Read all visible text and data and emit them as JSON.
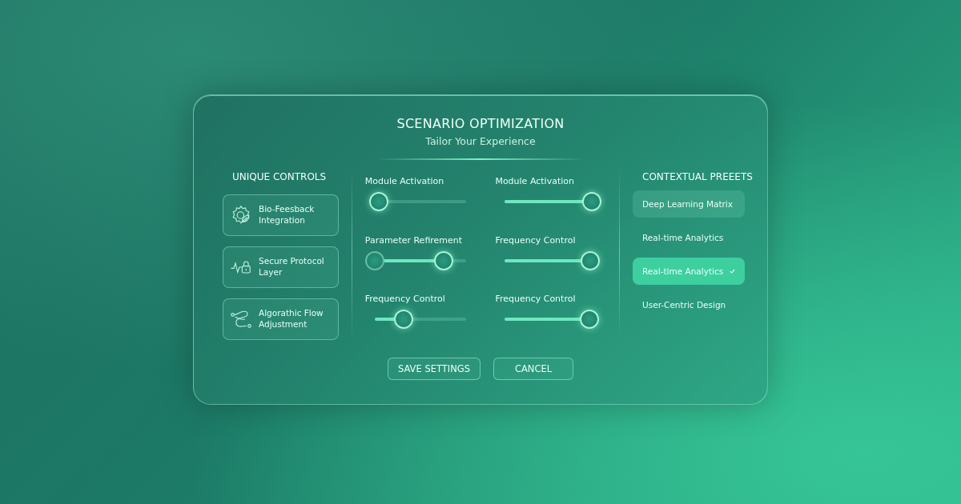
{
  "panel": {
    "title": "SCENARIO OPTIMIZATION",
    "subtitle": "Tailor Your Experience"
  },
  "unique_controls": {
    "heading": "UNIQUE CONTROLS",
    "items": [
      {
        "kind": "gear-leaf",
        "label": "Bio-Feesback Integration"
      },
      {
        "kind": "pulse-lock",
        "label": "Secure Protocol Layer"
      },
      {
        "kind": "flow",
        "label": "Algorathic Flow Adjustment"
      }
    ]
  },
  "sliders": [
    {
      "kind": "single",
      "label": "Module Activation",
      "level": 0.05
    },
    {
      "kind": "single",
      "label": "Module Activation",
      "level": 0.95
    },
    {
      "kind": "range",
      "label": "Parameter Refirement",
      "level": 0.75
    },
    {
      "kind": "single",
      "label": "Frequency Control",
      "level": 0.93
    },
    {
      "kind": "single",
      "label": "Frequency Control",
      "level": 0.32
    },
    {
      "kind": "single",
      "label": "Frequency Control",
      "level": 0.92
    }
  ],
  "presets": {
    "heading": "CONTEXTUAL PREEETS",
    "items": [
      {
        "label": "Deep Learning Matrix",
        "hovered": true,
        "selected": false
      },
      {
        "label": "Real-time Analytics",
        "hovered": false,
        "selected": false
      },
      {
        "label": "Real-time Analytics",
        "hovered": false,
        "selected": true
      },
      {
        "label": "User-Centric Design",
        "hovered": false,
        "selected": false
      }
    ]
  },
  "buttons": [
    {
      "label": "SAVE SETTINGS"
    },
    {
      "label": "CANCEL"
    }
  ]
}
